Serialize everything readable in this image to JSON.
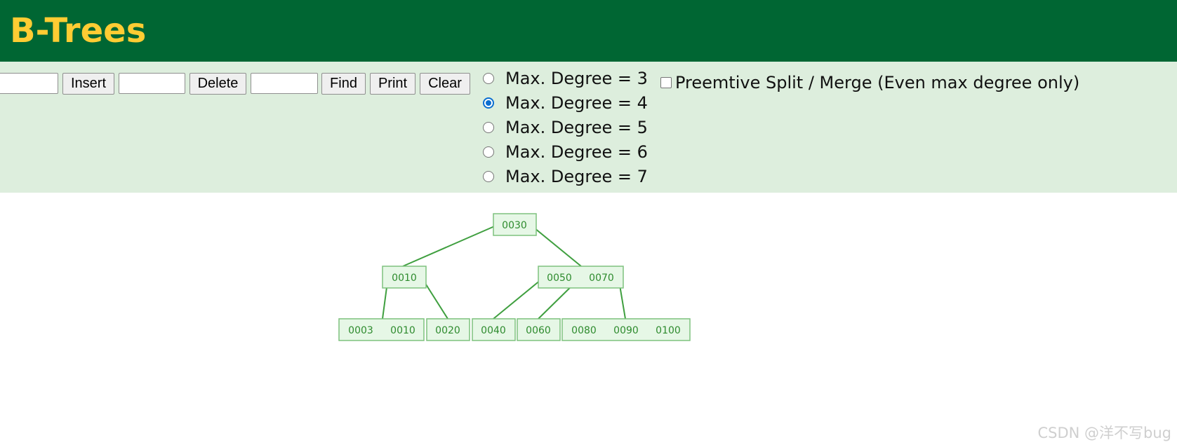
{
  "header": {
    "title": "B-Trees",
    "bg_color": "#006633",
    "title_color": "#ffcc33"
  },
  "toolbar": {
    "insert_input_value": "",
    "insert_label": "Insert",
    "delete_input_value": "",
    "delete_label": "Delete",
    "find_input_value": "",
    "find_label": "Find",
    "print_label": "Print",
    "clear_label": "Clear"
  },
  "degree_options": [
    {
      "label": "Max. Degree = 3",
      "selected": false
    },
    {
      "label": "Max. Degree = 4",
      "selected": true
    },
    {
      "label": "Max. Degree = 5",
      "selected": false
    },
    {
      "label": "Max. Degree = 6",
      "selected": false
    },
    {
      "label": "Max. Degree = 7",
      "selected": false
    }
  ],
  "preemptive": {
    "label": "Preemtive Split / Merge (Even max degree only)",
    "checked": false
  },
  "tree": {
    "root": {
      "keys": [
        "0030"
      ]
    },
    "internal": [
      {
        "keys": [
          "0010"
        ]
      },
      {
        "keys": [
          "0050",
          "0070"
        ]
      }
    ],
    "leaves": [
      {
        "keys": [
          "0003",
          "0010"
        ]
      },
      {
        "keys": [
          "0020"
        ]
      },
      {
        "keys": [
          "0040"
        ]
      },
      {
        "keys": [
          "0060"
        ]
      },
      {
        "keys": [
          "0080",
          "0090",
          "0100"
        ]
      }
    ],
    "colors": {
      "node_fill": "#e6f7e6",
      "node_border": "#7fc27f",
      "edge": "#3f9f3f",
      "key_text": "#2e8b2e"
    }
  },
  "watermark": "CSDN @洋不写bug"
}
